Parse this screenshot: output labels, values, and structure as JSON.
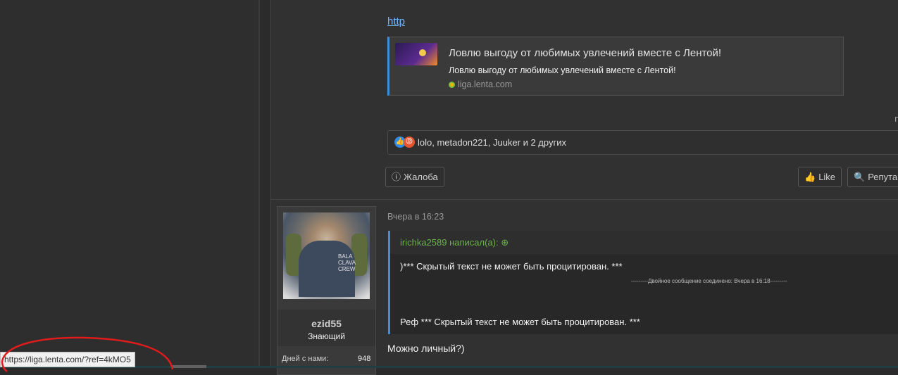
{
  "post": {
    "link_text": "http",
    "embed": {
      "title": "Ловлю выгоду от любимых увлечений вместе с Лентой!",
      "description": "Ловлю выгоду от любимых увлечений вместе с Лентой!",
      "site": "liga.lenta.com"
    },
    "edge_char": "г",
    "reactions": {
      "text": "lolo, metadon221, Juuker и 2 других",
      "like_icon": "like-icon",
      "angry_icon": "angry-icon"
    },
    "report_label": "Жалоба",
    "like_label": "Like",
    "reputation_label": "Репута"
  },
  "user": {
    "name": "ezid55",
    "role": "Знающий",
    "stat_label": "Дней с нами:",
    "stat_value": "948",
    "avatar_text": "BALA CLAVA CREW"
  },
  "reply": {
    "time": "Вчера в 16:23",
    "quote_author": "irichka2589 написал(а): ",
    "quote_line1": ")*** Скрытый текст не может быть процитирован. ***",
    "quote_merged": "---------Двойное сообщение соединено: Вчера в 16:18---------",
    "quote_line2": "Реф *** Скрытый текст не может быть процитирован. ***",
    "text": "Можно личный?)"
  },
  "status_bar": {
    "url": "https://liga.lenta.com/?ref=4kMO5"
  },
  "colors": {
    "link": "#6fb6ff",
    "accent_blue": "#3f8fd8",
    "quote_green": "#6ab04c",
    "annotation_red": "#e01b1b"
  }
}
